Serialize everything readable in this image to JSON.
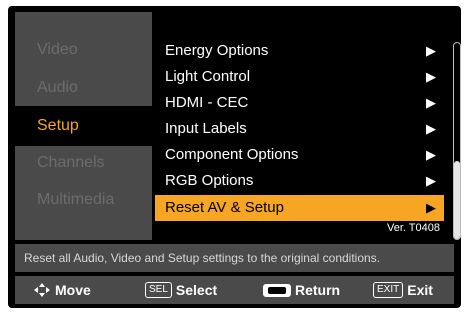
{
  "sidebar": {
    "items": [
      {
        "label": "Video"
      },
      {
        "label": "Audio"
      },
      {
        "label": "Setup"
      },
      {
        "label": "Channels"
      },
      {
        "label": "Multimedia"
      }
    ]
  },
  "menu": {
    "items": [
      {
        "label": "Energy Options",
        "arrow": "▶"
      },
      {
        "label": "Light Control",
        "arrow": "▶"
      },
      {
        "label": "HDMI - CEC",
        "arrow": "▶"
      },
      {
        "label": "Input Labels",
        "arrow": "▶"
      },
      {
        "label": "Component Options",
        "arrow": "▶"
      },
      {
        "label": "RGB Options",
        "arrow": "▶"
      },
      {
        "label": "Reset AV & Setup",
        "arrow": "▶"
      }
    ],
    "version": "Ver. T0408"
  },
  "description": "Reset all Audio, Video and Setup settings to the original conditions.",
  "footer": {
    "move": {
      "icon": "⬦",
      "label": "Move"
    },
    "select": {
      "key": "SEL",
      "label": "Select"
    },
    "return": {
      "label": "Return"
    },
    "exit": {
      "key": "EXIT",
      "label": "Exit"
    }
  },
  "colors": {
    "accent": "#f6a623",
    "panel": "#4a4a4a"
  }
}
